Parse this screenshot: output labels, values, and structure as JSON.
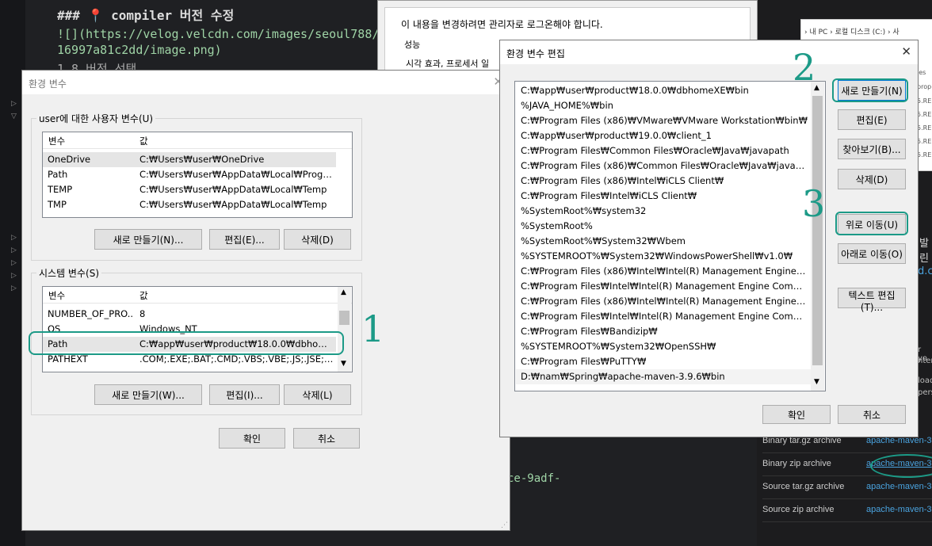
{
  "editor": {
    "heading": "### 📍 compiler 버전 수정",
    "line2": "![](https://velog.velcdn.com/images/seoul788/po",
    "line3": "16997a81c2dd/image.png)",
    "line4": "1.8 버전 선택",
    "fragment": "ce-9adf-"
  },
  "perf_dialog": {
    "notice": "이 내용을 변경하려면 관리자로 로그온해야 합니다.",
    "group_label": "성능",
    "group_text": "시각 효과, 프로세서 일"
  },
  "explorer": {
    "breadcrumb": "› 내 PC › 로컬 디스크 (C:) › 사",
    "items": [
      "ies",
      "prop",
      "5.REL",
      "5.REL",
      "5.REL",
      "5.REL",
      "5.REL"
    ]
  },
  "maven_page": {
    "frag1": "발린",
    "frag2": "d.c",
    "frag3": "r yo",
    "frag4": "nter",
    "frag5": "load",
    "frag6": "pers",
    "downloads": [
      {
        "name": "Binary tar.gz archive",
        "link": "apache-maven-3"
      },
      {
        "name": "Binary zip archive",
        "link": "apache-maven-3"
      },
      {
        "name": "Source tar.gz archive",
        "link": "apache-maven-3"
      },
      {
        "name": "Source zip archive",
        "link": "apache-maven-3"
      }
    ]
  },
  "env_dialog": {
    "title": "환경 변수",
    "user_group": "user에 대한 사용자 변수(U)",
    "col_var": "변수",
    "col_val": "값",
    "user_vars": [
      {
        "name": "OneDrive",
        "value": "C:₩Users₩user₩OneDrive"
      },
      {
        "name": "Path",
        "value": "C:₩Users₩user₩AppData₩Local₩Programs..."
      },
      {
        "name": "TEMP",
        "value": "C:₩Users₩user₩AppData₩Local₩Temp"
      },
      {
        "name": "TMP",
        "value": "C:₩Users₩user₩AppData₩Local₩Temp"
      }
    ],
    "user_new": "새로 만들기(N)...",
    "user_edit": "편집(E)...",
    "user_delete": "삭제(D)",
    "system_group": "시스템 변수(S)",
    "system_vars": [
      {
        "name": "NUMBER_OF_PRO...",
        "value": "8"
      },
      {
        "name": "OS",
        "value": "Windows_NT"
      },
      {
        "name": "Path",
        "value": "C:₩app₩user₩product₩18.0.0₩dbhomeXE..."
      },
      {
        "name": "PATHEXT",
        "value": ".COM;.EXE;.BAT;.CMD;.VBS;.VBE;.JS;.JSE;.W..."
      }
    ],
    "sys_new": "새로 만들기(W)...",
    "sys_edit": "편집(I)...",
    "sys_delete": "삭제(L)",
    "ok": "확인",
    "cancel": "취소"
  },
  "edit_dialog": {
    "title": "환경 변수 편집",
    "paths": [
      "C:₩app₩user₩product₩18.0.0₩dbhomeXE₩bin",
      "%JAVA_HOME%₩bin",
      "C:₩Program Files (x86)₩VMware₩VMware Workstation₩bin₩",
      "C:₩app₩user₩product₩19.0.0₩client_1",
      "C:₩Program Files₩Common Files₩Oracle₩Java₩javapath",
      "C:₩Program Files (x86)₩Common Files₩Oracle₩Java₩javapath",
      "C:₩Program Files (x86)₩Intel₩iCLS Client₩",
      "C:₩Program Files₩Intel₩iCLS Client₩",
      "%SystemRoot%₩system32",
      "%SystemRoot%",
      "%SystemRoot%₩System32₩Wbem",
      "%SYSTEMROOT%₩System32₩WindowsPowerShell₩v1.0₩",
      "C:₩Program Files (x86)₩Intel₩Intel(R) Management Engine Com...",
      "C:₩Program Files₩Intel₩Intel(R) Management Engine Componen...",
      "C:₩Program Files (x86)₩Intel₩Intel(R) Management Engine Com...",
      "C:₩Program Files₩Intel₩Intel(R) Management Engine Componen...",
      "C:₩Program Files₩Bandizip₩",
      "%SYSTEMROOT%₩System32₩OpenSSH₩",
      "C:₩Program Files₩PuTTY₩",
      "D:₩nam₩Spring₩apache-maven-3.9.6₩bin"
    ],
    "btn_new": "새로 만들기(N)",
    "btn_edit": "편집(E)",
    "btn_browse": "찾아보기(B)...",
    "btn_delete": "삭제(D)",
    "btn_up": "위로 이동(U)",
    "btn_down": "아래로 이동(O)",
    "btn_text": "텍스트 편집(T)...",
    "ok": "확인",
    "cancel": "취소"
  },
  "annotations": {
    "n1": "1",
    "n2": "2",
    "n3": "3",
    "color": "#1c9a87"
  }
}
